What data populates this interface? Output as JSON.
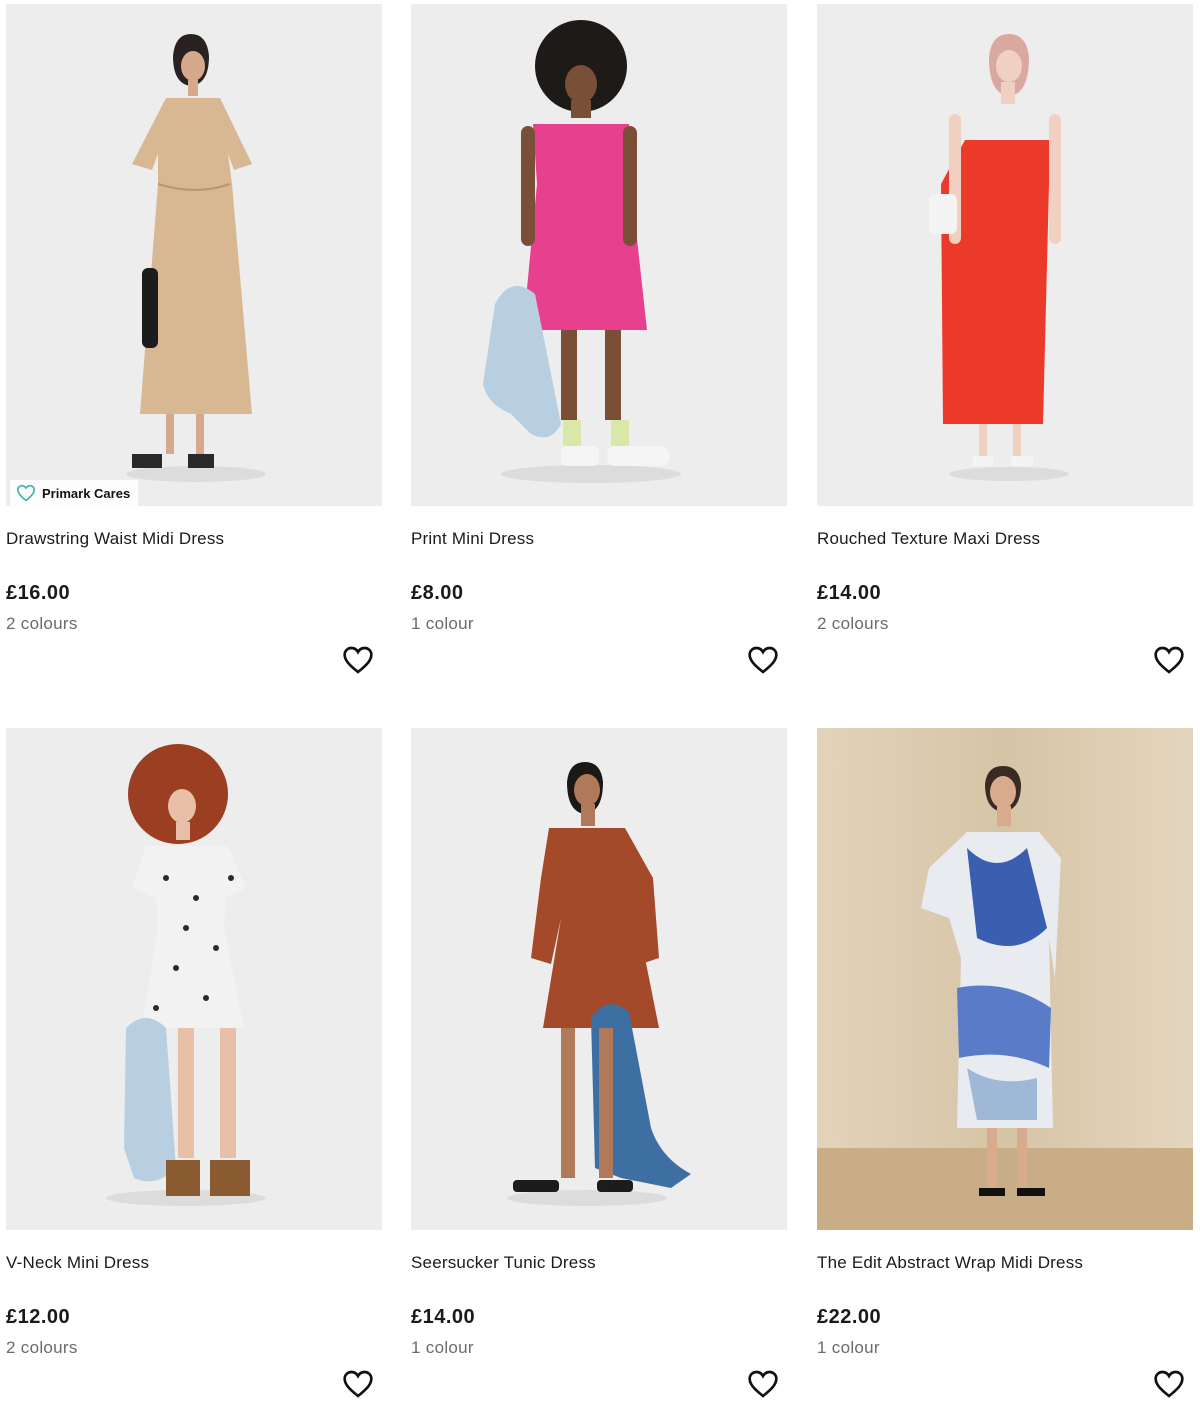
{
  "products": [
    {
      "title": "Drawstring Waist Midi Dress",
      "price": "£16.00",
      "colours": "2 colours",
      "badge": "Primark Cares"
    },
    {
      "title": "Print Mini Dress",
      "price": "£8.00",
      "colours": "1 colour"
    },
    {
      "title": "Rouched Texture Maxi Dress",
      "price": "£14.00",
      "colours": "2 colours"
    },
    {
      "title": "V-Neck Mini Dress",
      "price": "£12.00",
      "colours": "2 colours"
    },
    {
      "title": "Seersucker Tunic Dress",
      "price": "£14.00",
      "colours": "1 colour"
    },
    {
      "title": "The Edit Abstract Wrap Midi Dress",
      "price": "£22.00",
      "colours": "1 colour"
    }
  ],
  "icons": {
    "wishlist": "heart-icon",
    "badge": "heart-outline-icon"
  },
  "colors": {
    "badge_icon": "#3bb5a8",
    "image_bg": "#ededed",
    "muted_text": "#6b6b6b"
  }
}
